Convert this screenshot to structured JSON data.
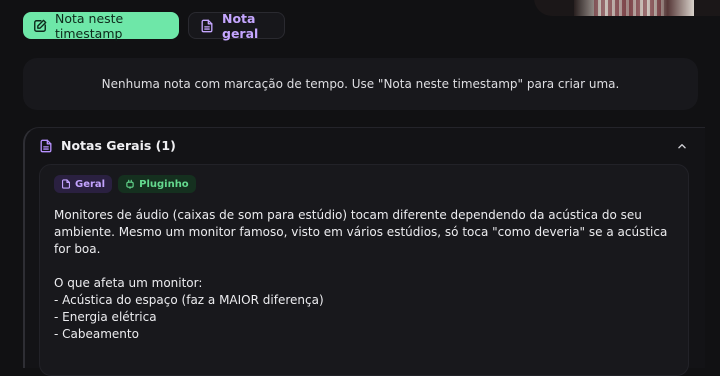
{
  "toolbar": {
    "timestamp_button_label": "Nota neste timestamp",
    "general_button_label": "Nota geral"
  },
  "empty_state": {
    "message": "Nenhuma nota com marcação de tempo. Use \"Nota neste timestamp\" para criar uma."
  },
  "general_notes": {
    "header": "Notas Gerais (1)",
    "notes": [
      {
        "tags": [
          "Geral",
          "Pluginho"
        ],
        "text": "Monitores de áudio (caixas de som para estúdio) tocam diferente dependendo da acústica do seu ambiente. Mesmo um monitor famoso, visto em vários estúdios, só toca \"como deveria\" se a acústica for boa.\n\nO que afeta um monitor:\n- Acústica do espaço (faz a MAIOR diferença)\n- Energia elétrica\n- Cabeamento"
      }
    ]
  },
  "colors": {
    "primary_accent": "#6ee7a8",
    "secondary_accent": "#c5a6ff",
    "background": "#111113"
  },
  "icons": {
    "timestamp_button": "note-edit-icon",
    "general_button": "document-icon",
    "header": "document-icon",
    "collapse": "chevron-up-icon",
    "tag_geral": "document-icon",
    "tag_plug": "plug-icon"
  }
}
